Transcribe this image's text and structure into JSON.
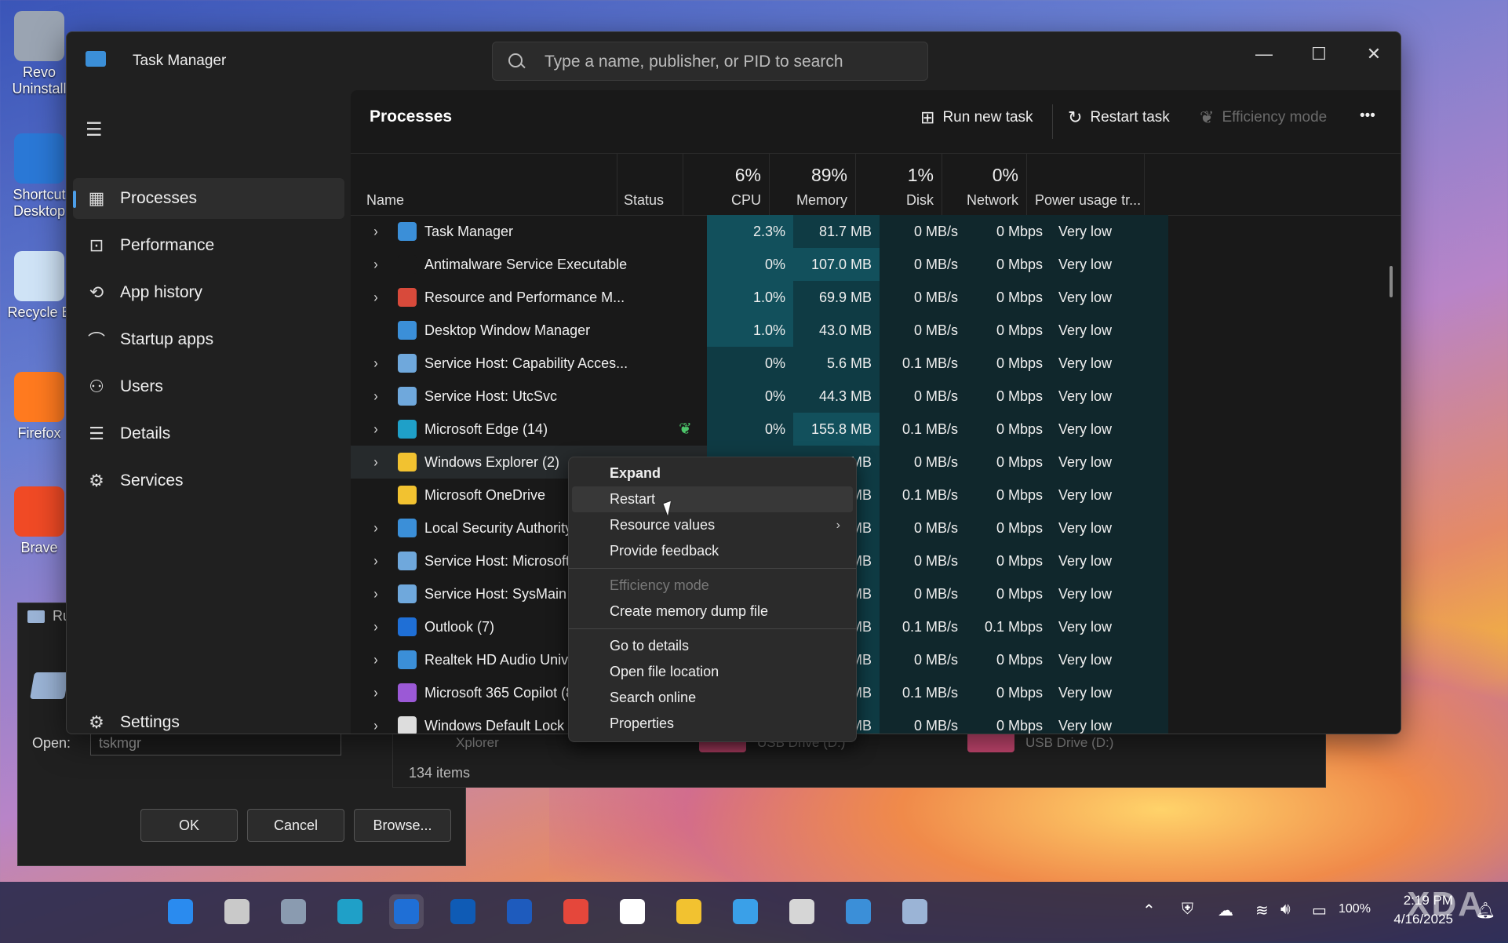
{
  "desktop": {
    "icons": [
      {
        "label": "Revo Uninstall",
        "color": "#9aa4b2"
      },
      {
        "label": "Shortcut Desktop",
        "color": "#2a78d6"
      },
      {
        "label": "Recycle B",
        "color": "#cfe3f6"
      },
      {
        "label": "Firefox",
        "color": "#ff7a1f"
      },
      {
        "label": "Brave",
        "color": "#f04a25"
      }
    ]
  },
  "run_dialog": {
    "title": "Ru",
    "open_label": "Open:",
    "open_value": "tskmgr",
    "ok": "OK",
    "cancel": "Cancel",
    "browse": "Browse..."
  },
  "explorer_bg": {
    "status": "134 items",
    "item": "Xplorer",
    "drive1": "USB Drive (D:)",
    "drive2": "USB Drive (D:)"
  },
  "task_manager": {
    "title": "Task Manager",
    "search_placeholder": "Type a name, publisher, or PID to search",
    "nav": [
      {
        "label": "Processes",
        "icon": "processes-icon",
        "glyph": "▦"
      },
      {
        "label": "Performance",
        "icon": "performance-icon",
        "glyph": "⊡"
      },
      {
        "label": "App history",
        "icon": "app-history-icon",
        "glyph": "⟲"
      },
      {
        "label": "Startup apps",
        "icon": "startup-apps-icon",
        "glyph": "⌒"
      },
      {
        "label": "Users",
        "icon": "users-icon",
        "glyph": "⚇"
      },
      {
        "label": "Details",
        "icon": "details-icon",
        "glyph": "☰"
      },
      {
        "label": "Services",
        "icon": "services-icon",
        "glyph": "⚙"
      }
    ],
    "settings_label": "Settings",
    "page_title": "Processes",
    "toolbar": {
      "run_new_task": "Run new task",
      "restart_task": "Restart task",
      "efficiency_mode": "Efficiency mode",
      "more": "•••"
    },
    "columns": {
      "name": "Name",
      "status": "Status",
      "cpu_pct": "6%",
      "cpu": "CPU",
      "memory_pct": "89%",
      "memory": "Memory",
      "disk_pct": "1%",
      "disk": "Disk",
      "network_pct": "0%",
      "network": "Network",
      "power": "Power usage tr..."
    },
    "rows": [
      {
        "name": "Task Manager",
        "expand": true,
        "icon_color": "#3b8fd8",
        "cpu": "2.3%",
        "mem": "81.7 MB",
        "disk": "0 MB/s",
        "net": "0 Mbps",
        "pwr": "Very low"
      },
      {
        "name": "Antimalware Service Executable",
        "expand": true,
        "icon_color": "#191919",
        "cpu": "0%",
        "mem": "107.0 MB",
        "disk": "0 MB/s",
        "net": "0 Mbps",
        "pwr": "Very low"
      },
      {
        "name": "Resource and Performance M...",
        "expand": true,
        "icon_color": "#d84a3b",
        "cpu": "1.0%",
        "mem": "69.9 MB",
        "disk": "0 MB/s",
        "net": "0 Mbps",
        "pwr": "Very low"
      },
      {
        "name": "Desktop Window Manager",
        "expand": false,
        "icon_color": "#3b8fd8",
        "cpu": "1.0%",
        "mem": "43.0 MB",
        "disk": "0 MB/s",
        "net": "0 Mbps",
        "pwr": "Very low"
      },
      {
        "name": "Service Host: Capability Acces...",
        "expand": true,
        "icon_color": "#6fa8dc",
        "cpu": "0%",
        "mem": "5.6 MB",
        "disk": "0.1 MB/s",
        "net": "0 Mbps",
        "pwr": "Very low"
      },
      {
        "name": "Service Host: UtcSvc",
        "expand": true,
        "icon_color": "#6fa8dc",
        "cpu": "0%",
        "mem": "44.3 MB",
        "disk": "0 MB/s",
        "net": "0 Mbps",
        "pwr": "Very low"
      },
      {
        "name": "Microsoft Edge (14)",
        "expand": true,
        "icon_color": "#1fa0c8",
        "cpu": "0%",
        "mem": "155.8 MB",
        "disk": "0.1 MB/s",
        "net": "0 Mbps",
        "pwr": "Very low",
        "efficiency": true
      },
      {
        "name": "Windows Explorer (2)",
        "expand": true,
        "icon_color": "#f2c230",
        "cpu": "",
        "mem": "MB",
        "disk": "0 MB/s",
        "net": "0 Mbps",
        "pwr": "Very low"
      },
      {
        "name": "Microsoft OneDrive",
        "expand": false,
        "icon_color": "#f2c230",
        "cpu": "",
        "mem": "MB",
        "disk": "0.1 MB/s",
        "net": "0 Mbps",
        "pwr": "Very low"
      },
      {
        "name": "Local Security Authority",
        "expand": true,
        "icon_color": "#3b8fd8",
        "cpu": "",
        "mem": "MB",
        "disk": "0 MB/s",
        "net": "0 Mbps",
        "pwr": "Very low"
      },
      {
        "name": "Service Host: Microsoft",
        "expand": true,
        "icon_color": "#6fa8dc",
        "cpu": "",
        "mem": "MB",
        "disk": "0 MB/s",
        "net": "0 Mbps",
        "pwr": "Very low"
      },
      {
        "name": "Service Host: SysMain",
        "expand": true,
        "icon_color": "#6fa8dc",
        "cpu": "",
        "mem": "MB",
        "disk": "0 MB/s",
        "net": "0 Mbps",
        "pwr": "Very low"
      },
      {
        "name": "Outlook (7)",
        "expand": true,
        "icon_color": "#1f6fd6",
        "cpu": "",
        "mem": "MB",
        "disk": "0.1 MB/s",
        "net": "0.1 Mbps",
        "pwr": "Very low"
      },
      {
        "name": "Realtek HD Audio Unive",
        "expand": true,
        "icon_color": "#3b8fd8",
        "cpu": "",
        "mem": "MB",
        "disk": "0 MB/s",
        "net": "0 Mbps",
        "pwr": "Very low"
      },
      {
        "name": "Microsoft 365 Copilot (8",
        "expand": true,
        "icon_color": "#9b59d6",
        "cpu": "",
        "mem": "MB",
        "disk": "0.1 MB/s",
        "net": "0 Mbps",
        "pwr": "Very low"
      },
      {
        "name": "Windows Default Lock S",
        "expand": true,
        "icon_color": "#dddddd",
        "cpu": "",
        "mem": "MB",
        "disk": "0 MB/s",
        "net": "0 Mbps",
        "pwr": "Very low"
      }
    ],
    "context_menu": {
      "expand": "Expand",
      "restart": "Restart",
      "resource_values": "Resource values",
      "provide_feedback": "Provide feedback",
      "efficiency_mode": "Efficiency mode",
      "create_dump": "Create memory dump file",
      "go_to_details": "Go to details",
      "open_file_location": "Open file location",
      "search_online": "Search online",
      "properties": "Properties"
    }
  },
  "taskbar": {
    "apps": [
      {
        "name": "start-icon",
        "color": "#2a8bef"
      },
      {
        "name": "task-view-icon",
        "color": "#c9c9c9"
      },
      {
        "name": "settings-app-icon",
        "color": "#8a9bb0"
      },
      {
        "name": "edge-icon",
        "color": "#1fa0c8"
      },
      {
        "name": "outlook-new-icon",
        "color": "#1f6fd6"
      },
      {
        "name": "outlook-icon",
        "color": "#0f5bb5"
      },
      {
        "name": "word-icon",
        "color": "#1e5bbd"
      },
      {
        "name": "chrome-icon",
        "color": "#e5473b"
      },
      {
        "name": "7zip-icon",
        "color": "#ffffff"
      },
      {
        "name": "file-explorer-icon",
        "color": "#f2c230"
      },
      {
        "name": "photos-icon",
        "color": "#3aa0e8"
      },
      {
        "name": "resource-monitor-icon",
        "color": "#d6d6d6"
      },
      {
        "name": "task-manager-icon",
        "color": "#3b8fd8"
      },
      {
        "name": "run-icon",
        "color": "#9bb4d6"
      }
    ],
    "battery": "100%",
    "time": "2:19 PM",
    "date": "4/16/2025",
    "brand": "XDA"
  }
}
